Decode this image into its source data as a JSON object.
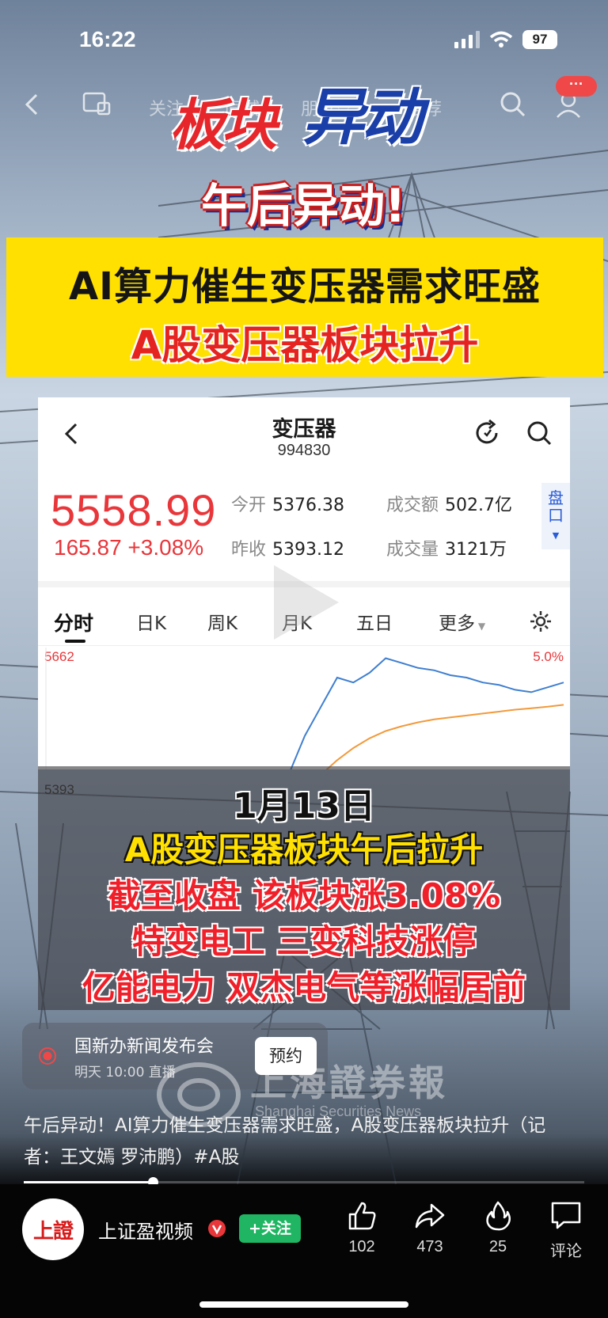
{
  "status": {
    "time": "16:22",
    "battery": "97"
  },
  "nav": {
    "tabs": [
      "关注",
      "同城",
      "朋友♡",
      "推荐"
    ],
    "more_label": "···"
  },
  "banner": {
    "logo_part1": "板块",
    "logo_part2": "异动",
    "tag": "午后异动!",
    "line1": "AI算力催生变压器需求旺盛",
    "line2": "A股变压器板块拉升"
  },
  "stock": {
    "name": "变压器",
    "code": "994830",
    "price": "5558.99",
    "change": "165.87  +3.08%",
    "open_label": "今开",
    "open_value": "5376.38",
    "prev_label": "昨收",
    "prev_value": "5393.12",
    "amount_label": "成交额",
    "amount_value": "502.7亿",
    "volume_label": "成交量",
    "volume_value": "3121万",
    "pankou": "盘口",
    "tabs": [
      "分时",
      "日K",
      "周K",
      "月K",
      "五日",
      "更多"
    ],
    "axis_high": "5662",
    "axis_prev": "5393",
    "axis_pct": "5.0%"
  },
  "chart_data": {
    "type": "line",
    "title": "",
    "ylim": [
      5124,
      5662
    ],
    "prev_close": 5393,
    "series": [
      {
        "values": [
          5355,
          5330,
          5345,
          5360,
          5340,
          5338,
          5352,
          5340,
          5335,
          5345,
          5350,
          5342,
          5338,
          5340,
          5335,
          5400,
          5480,
          5540,
          5600,
          5590,
          5610,
          5640,
          5630,
          5620,
          5615,
          5605,
          5600,
          5590,
          5585,
          5575,
          5570,
          5580,
          5590
        ]
      },
      {
        "values": [
          5350,
          5345,
          5343,
          5343,
          5344,
          5343,
          5343,
          5343,
          5343,
          5343,
          5344,
          5344,
          5343,
          5343,
          5343,
          5345,
          5365,
          5400,
          5430,
          5455,
          5475,
          5490,
          5500,
          5508,
          5514,
          5518,
          5522,
          5526,
          5530,
          5534,
          5537,
          5540,
          5544
        ]
      }
    ],
    "colors": [
      "#3f7fd0",
      "#f29a3c"
    ]
  },
  "caption": {
    "date": "1月13日",
    "line1": "A股变压器板块午后拉升",
    "line2": "截至收盘 该板块涨3.08%",
    "line3": "特变电工 三变科技涨停",
    "line4": "亿能电力 双杰电气等涨幅居前"
  },
  "live": {
    "title": "国新办新闻发布会",
    "subtitle": "明天 10:00 直播",
    "button": "预约"
  },
  "watermark": {
    "cn": "上海證券報",
    "en": "Shanghai Securities News"
  },
  "description": "午后异动！AI算力催生变压器需求旺盛，A股变压器板块拉升（记者：王文嫣 罗沛鹏）#A股",
  "progress": 0.23,
  "author": {
    "avatar_text": "上證",
    "name": "上证盈视频",
    "follow": "+关注"
  },
  "actions": {
    "like": "102",
    "share": "473",
    "fire": "25",
    "comment": "评论"
  }
}
